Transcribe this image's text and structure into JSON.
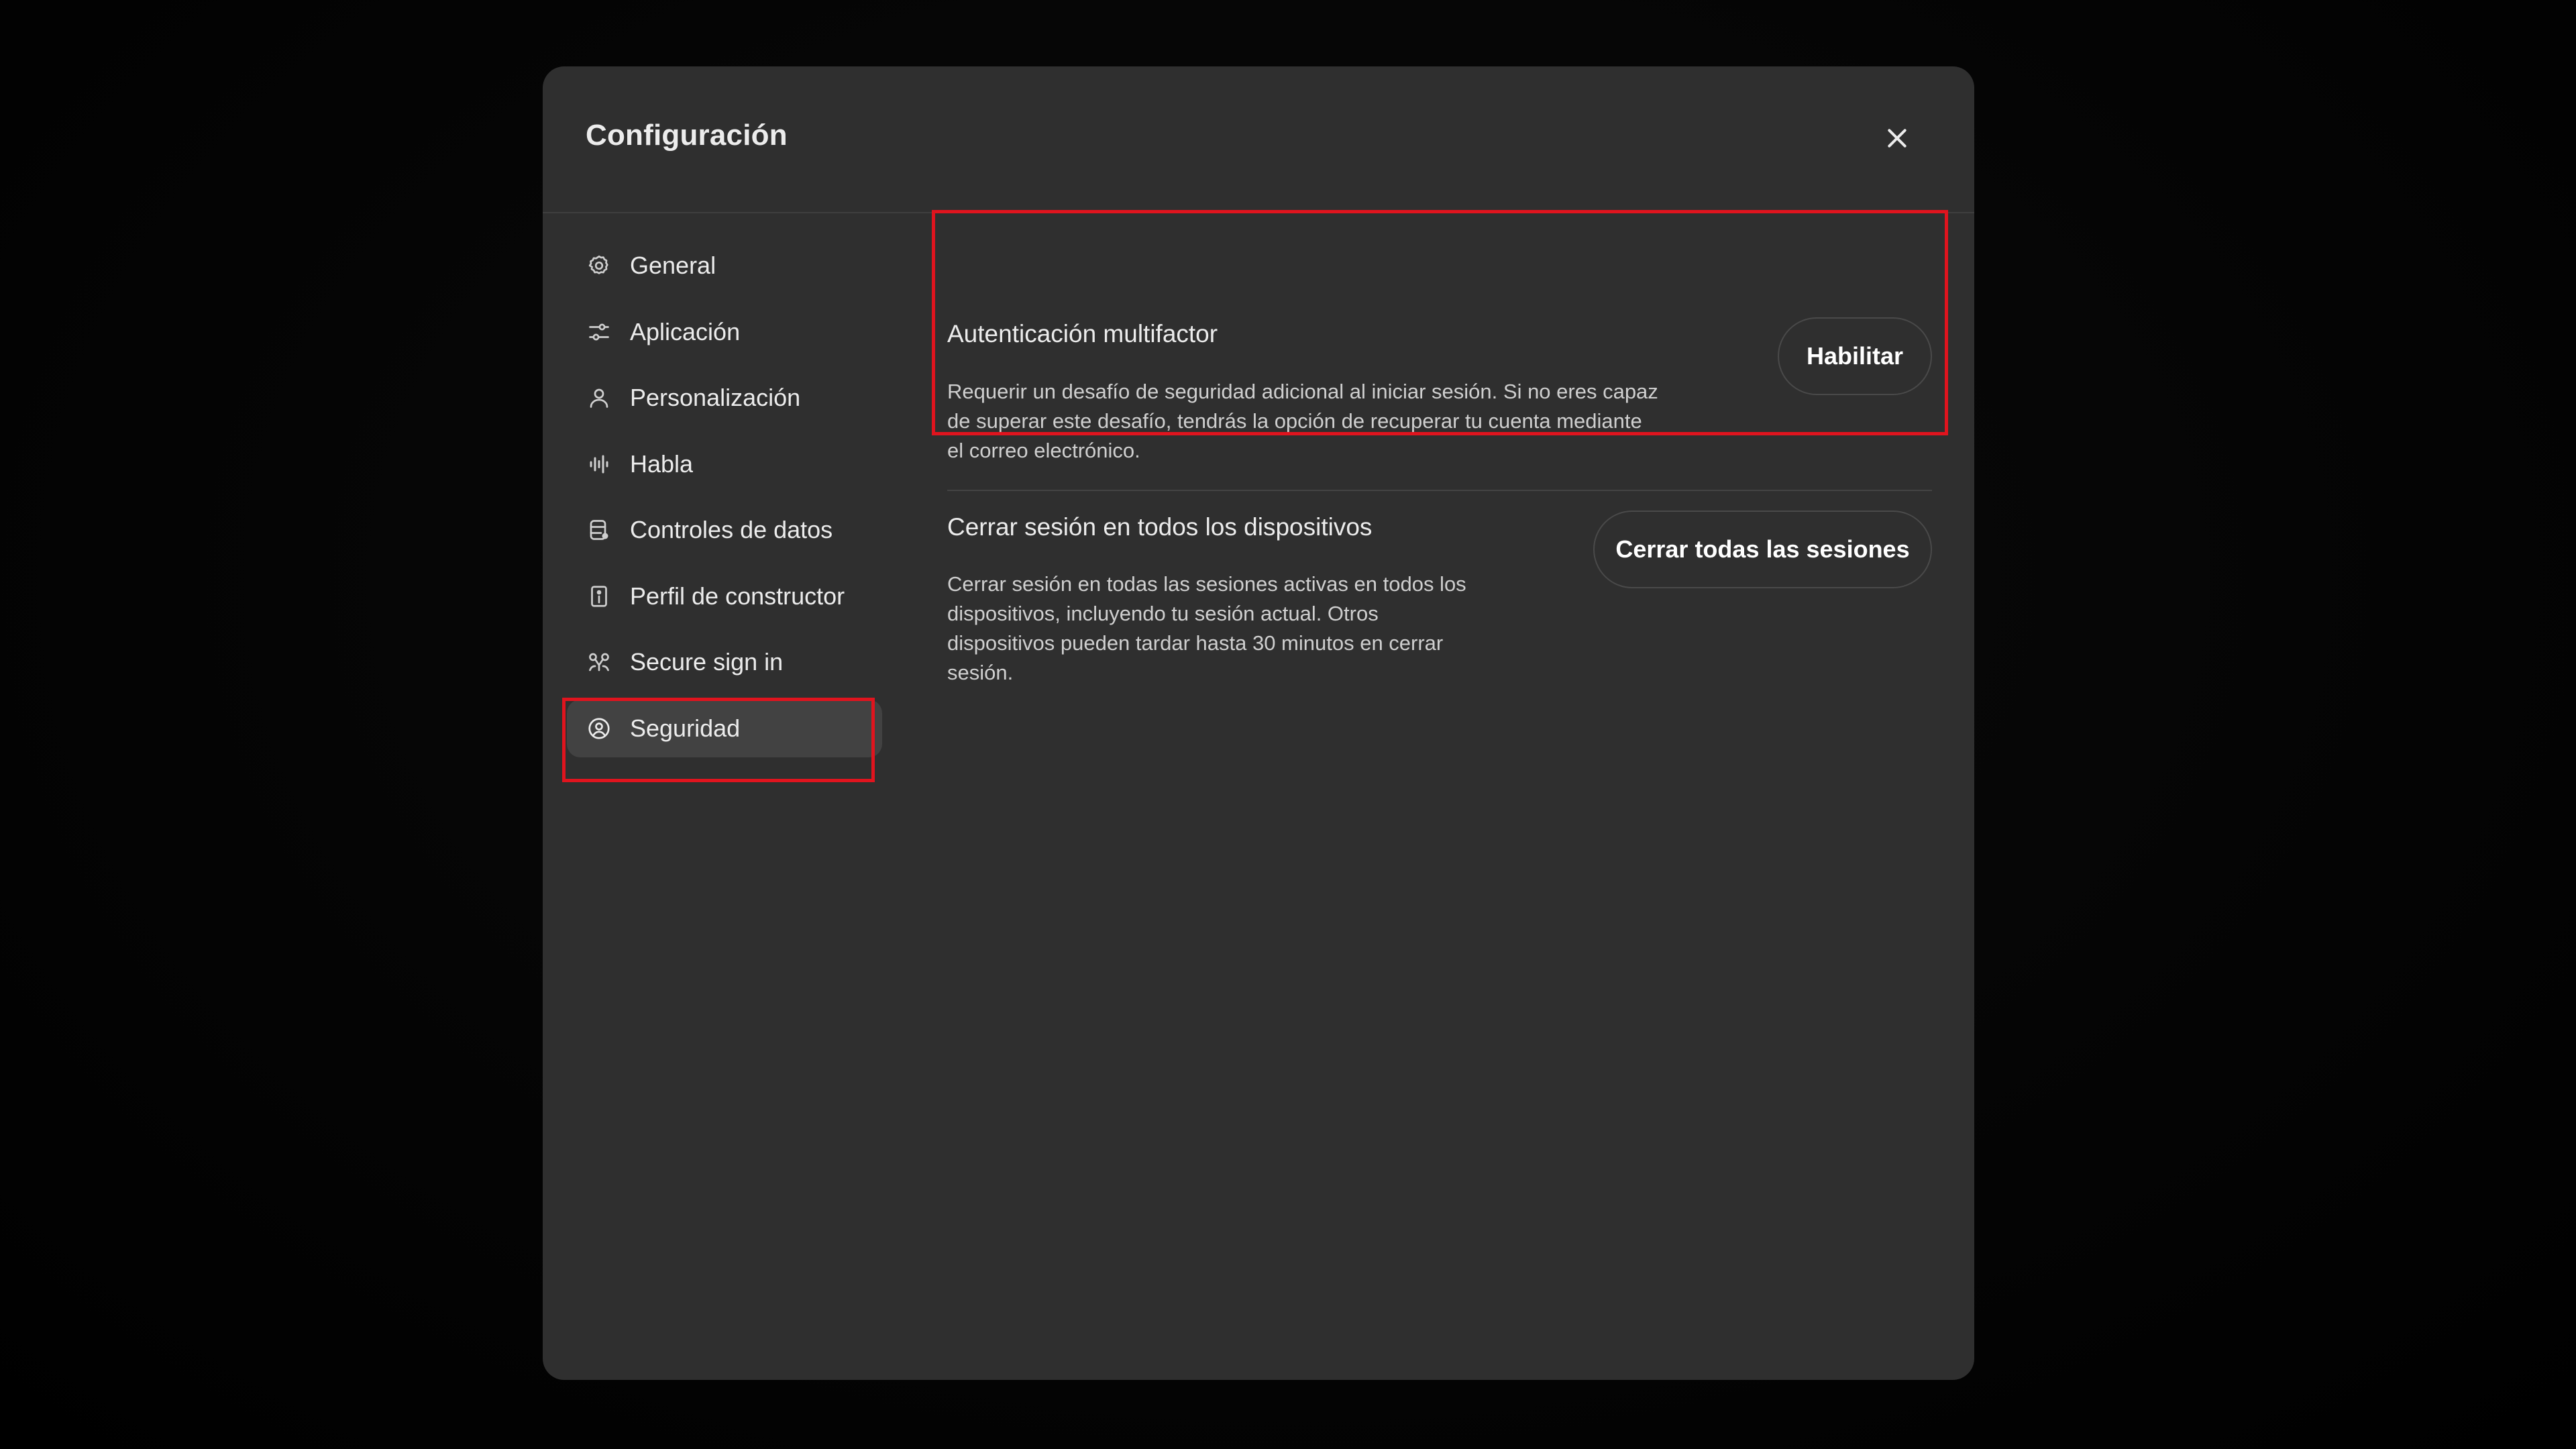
{
  "dialog": {
    "title": "Configuración",
    "close_label": "close"
  },
  "sidebar": {
    "items": [
      {
        "label": "General",
        "icon": "gear-icon"
      },
      {
        "label": "Aplicación",
        "icon": "sliders-icon"
      },
      {
        "label": "Personalización",
        "icon": "user-icon"
      },
      {
        "label": "Habla",
        "icon": "waveform-icon"
      },
      {
        "label": "Controles de datos",
        "icon": "database-icon"
      },
      {
        "label": "Perfil de constructor",
        "icon": "id-card-icon"
      },
      {
        "label": "Secure sign in",
        "icon": "network-icon"
      },
      {
        "label": "Seguridad",
        "icon": "shield-user-icon",
        "active": true
      }
    ]
  },
  "security": {
    "mfa": {
      "title": "Autenticación multifactor",
      "description_lines": [
        "Requerir un desafío de seguridad adicional al iniciar sesión. Si no eres capaz",
        "de superar este desafío, tendrás la opción de recuperar tu cuenta mediante",
        "el correo electrónico."
      ],
      "button_label": "Habilitar"
    },
    "logout_all": {
      "title": "Cerrar sesión en todos los dispositivos",
      "description_lines": [
        "Cerrar sesión en todas las sesiones activas en todos los",
        "dispositivos, incluyendo tu sesión actual. Otros",
        "dispositivos pueden tardar hasta 30 minutos en cerrar",
        "sesión."
      ],
      "button_label": "Cerrar todas las sesiones"
    }
  },
  "colors": {
    "dialog_bg": "#2f2f2f",
    "active_item_bg": "#424242",
    "highlight": "#e0141e",
    "text_primary": "#ececec"
  }
}
